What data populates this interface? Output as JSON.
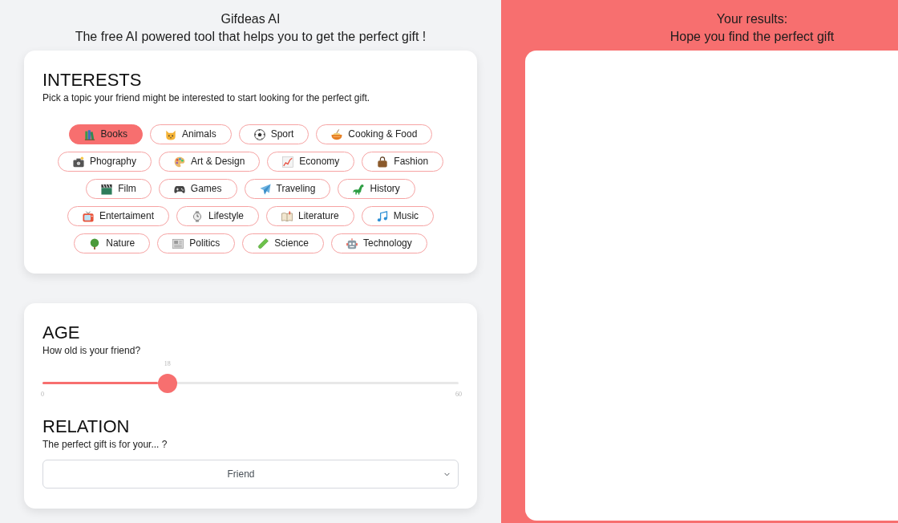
{
  "header": {
    "title": "Gifdeas AI",
    "subtitle": "The free AI powered tool that helps you to get the perfect gift !"
  },
  "interests": {
    "heading": "INTERESTS",
    "description": "Pick a topic your friend might be interested to start looking for the perfect gift.",
    "topics": [
      {
        "label": "Books",
        "selected": true
      },
      {
        "label": "Animals",
        "selected": false
      },
      {
        "label": "Sport",
        "selected": false
      },
      {
        "label": "Cooking & Food",
        "selected": false
      },
      {
        "label": "Phography",
        "selected": false
      },
      {
        "label": "Art & Design",
        "selected": false
      },
      {
        "label": "Economy",
        "selected": false
      },
      {
        "label": "Fashion",
        "selected": false
      },
      {
        "label": "Film",
        "selected": false
      },
      {
        "label": "Games",
        "selected": false
      },
      {
        "label": "Traveling",
        "selected": false
      },
      {
        "label": "History",
        "selected": false
      },
      {
        "label": "Entertaiment",
        "selected": false
      },
      {
        "label": "Lifestyle",
        "selected": false
      },
      {
        "label": "Literature",
        "selected": false
      },
      {
        "label": "Music",
        "selected": false
      },
      {
        "label": "Nature",
        "selected": false
      },
      {
        "label": "Politics",
        "selected": false
      },
      {
        "label": "Science",
        "selected": false
      },
      {
        "label": "Technology",
        "selected": false
      }
    ]
  },
  "age": {
    "heading": "AGE",
    "question": "How old is your friend?",
    "slider": {
      "value": "18",
      "min": "0",
      "max": "60",
      "level": 0.3
    }
  },
  "relation": {
    "heading": "RELATION",
    "question": "The perfect gift is for your... ?",
    "select": {
      "value": "Friend"
    }
  },
  "results": {
    "title": "Your results:",
    "subtitle": "Hope you find the perfect gift"
  }
}
